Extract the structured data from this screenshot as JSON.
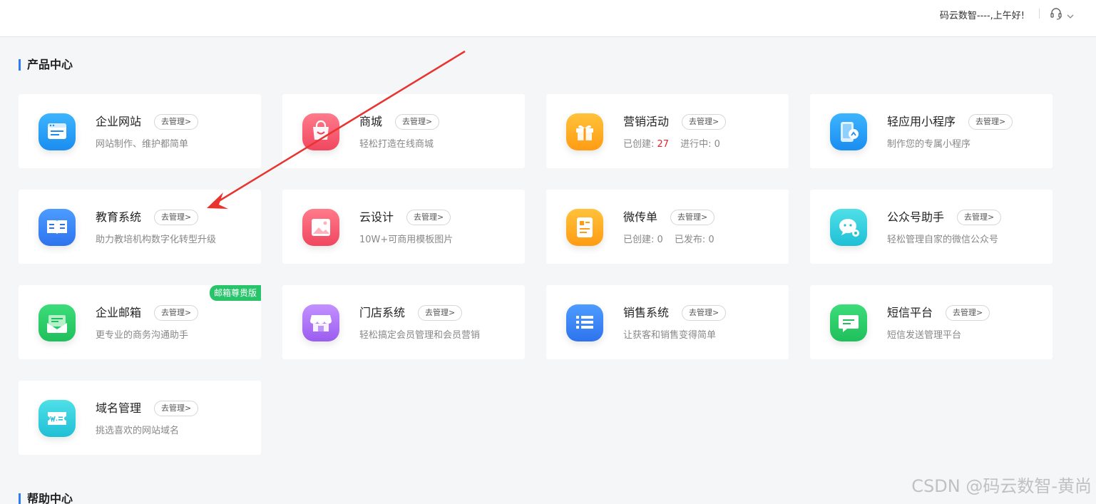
{
  "header": {
    "greeting": "码云数智----,上午好!"
  },
  "sections": {
    "product_center": "产品中心",
    "help_center": "帮助中心"
  },
  "manage_label": "去管理>",
  "cards": [
    {
      "name": "企业网站",
      "desc": "网站制作、维护都简单",
      "icon": "website-icon"
    },
    {
      "name": "商城",
      "desc": "轻松打造在线商城",
      "icon": "shopping-bag-icon"
    },
    {
      "name": "营销活动",
      "stats": [
        {
          "label": "已创建:",
          "value": "27"
        },
        {
          "label": "进行中:",
          "value": "0"
        }
      ],
      "icon": "gift-icon"
    },
    {
      "name": "轻应用小程序",
      "desc": "制作您的专属小程序",
      "icon": "mini-program-icon"
    },
    {
      "name": "教育系统",
      "desc": "助力教培机构数字化转型升级",
      "icon": "book-icon"
    },
    {
      "name": "云设计",
      "desc": "10W+可商用模板图片",
      "icon": "image-icon"
    },
    {
      "name": "微传单",
      "stats": [
        {
          "label": "已创建:",
          "value": "0"
        },
        {
          "label": "已发布:",
          "value": "0"
        }
      ],
      "icon": "flyer-icon"
    },
    {
      "name": "公众号助手",
      "desc": "轻松管理自家的微信公众号",
      "icon": "wechat-icon"
    },
    {
      "name": "企业邮箱",
      "desc": "更专业的商务沟通助手",
      "badge": "邮箱尊贵版",
      "icon": "mail-icon"
    },
    {
      "name": "门店系统",
      "desc": "轻松搞定会员管理和会员营销",
      "icon": "store-icon"
    },
    {
      "name": "销售系统",
      "desc": "让获客和销售变得简单",
      "icon": "list-icon"
    },
    {
      "name": "短信平台",
      "desc": "短信发送管理平台",
      "icon": "sms-icon"
    },
    {
      "name": "域名管理",
      "desc": "挑选喜欢的网站域名",
      "icon": "domain-icon"
    }
  ],
  "watermark": "CSDN @码云数智-黄尚",
  "colors": {
    "accent": "#2e7cf6",
    "stat_highlight": "#e0262a",
    "badge": "#27c46a",
    "arrow": "#e8332f"
  }
}
